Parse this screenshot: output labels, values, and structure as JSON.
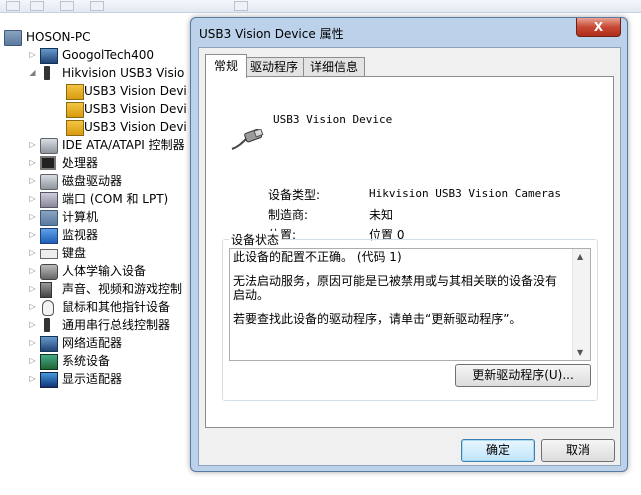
{
  "tree": {
    "root": "HOSON-PC",
    "items": [
      {
        "label": "GoogolTech400"
      },
      {
        "label": "Hikvision USB3 Visio"
      },
      {
        "label": "USB3 Vision Devi"
      },
      {
        "label": "USB3 Vision Devi"
      },
      {
        "label": "USB3 Vision Devi"
      },
      {
        "label": "IDE ATA/ATAPI 控制器"
      },
      {
        "label": "处理器"
      },
      {
        "label": "磁盘驱动器"
      },
      {
        "label": "端口 (COM 和 LPT)"
      },
      {
        "label": "计算机"
      },
      {
        "label": "监视器"
      },
      {
        "label": "键盘"
      },
      {
        "label": "人体学输入设备"
      },
      {
        "label": "声音、视频和游戏控制"
      },
      {
        "label": "鼠标和其他指针设备"
      },
      {
        "label": "通用串行总线控制器"
      },
      {
        "label": "网络适配器"
      },
      {
        "label": "系统设备"
      },
      {
        "label": "显示适配器"
      }
    ]
  },
  "dialog": {
    "title": "USB3 Vision Device 属性",
    "close_label": "X",
    "tabs": [
      {
        "label": "常规"
      },
      {
        "label": "驱动程序"
      },
      {
        "label": "详细信息"
      }
    ],
    "device_name": "USB3 Vision Device",
    "properties": {
      "type_label": "设备类型:",
      "type_value": "Hikvision USB3 Vision Cameras",
      "vendor_label": "制造商:",
      "vendor_value": "未知",
      "location_label": "位置:",
      "location_value": "位置 0"
    },
    "status": {
      "legend": "设备状态",
      "line1": "此设备的配置不正确。 (代码 1)",
      "line2": "无法启动服务，原因可能是已被禁用或与其相关联的设备没有启动。",
      "line3": "若要查找此设备的驱动程序，请单击“更新驱动程序”。"
    },
    "update_driver_label": "更新驱动程序(U)...",
    "ok_label": "确定",
    "cancel_label": "取消"
  }
}
